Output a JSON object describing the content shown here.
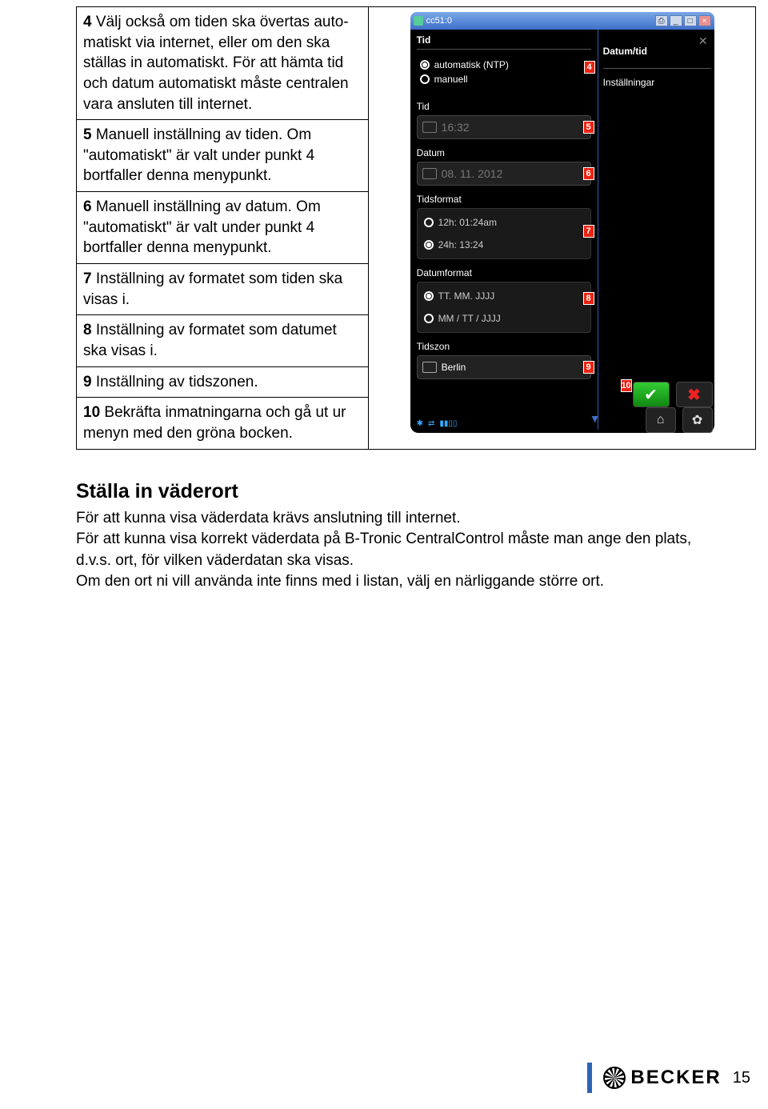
{
  "steps": {
    "s4": {
      "num": "4",
      "text": " Välj också om tiden ska övertas auto­matiskt via internet, eller om den ska stäl­las in automatiskt.\nFör att hämta tid och datum automatiskt måste centralen vara ansluten till internet."
    },
    "s5": {
      "num": "5",
      "text": " Manuell inställning av tiden.\nOm \"automatiskt\" är valt under punkt 4 bortfaller denna menypunkt."
    },
    "s6": {
      "num": "6",
      "text": " Manuell inställning av datum.\nOm \"automatiskt\" är valt under punkt 4 bortfaller denna menypunkt."
    },
    "s7": {
      "num": "7",
      "text": " Inställning av formatet som tiden ska vi­sas i."
    },
    "s8": {
      "num": "8",
      "text": " Inställning av formatet som datumet ska visas i."
    },
    "s9": {
      "num": "9",
      "text": " Inställning av tidszonen."
    },
    "s10": {
      "num": "10",
      "text": " Bekräfta inmatningarna och gå ut ur menyn med den gröna bocken."
    }
  },
  "device": {
    "titlebar": "cc51:0",
    "right": {
      "datumtid": "Datum/tid",
      "installningar": "Inställningar"
    },
    "sec_tid": "Tid",
    "radio_auto": "automatisk (NTP)",
    "radio_manuell": "manuell",
    "sec_tid2": "Tid",
    "time_value": "16:32",
    "sec_datum": "Datum",
    "date_value": "08. 11. 2012",
    "sec_tidsformat": "Tidsformat",
    "tf_12h": "12h: 01:24am",
    "tf_24h": "24h: 13:24",
    "sec_datumformat": "Datumformat",
    "df_1": "TT. MM. JJJJ",
    "df_2": "MM / TT / JJJJ",
    "sec_tidszon": "Tidszon",
    "tz_value": "Berlin",
    "callouts": {
      "c4": "4",
      "c5": "5",
      "c6": "6",
      "c7": "7",
      "c8": "8",
      "c9": "9",
      "c10": "10"
    }
  },
  "section2": {
    "heading": "Ställa in väderort",
    "body": "För att kunna visa väderdata krävs anslutning till internet.\nFör att kunna visa korrekt väderdata på B-Tronic CentralControl måste man ange den plats, d.v.s. ort, för vilken väderdatan ska visas.\nOm den ort ni vill använda inte finns med i listan, välj en närliggande större ort."
  },
  "footer": {
    "brand": "BECKER",
    "page": "15"
  }
}
